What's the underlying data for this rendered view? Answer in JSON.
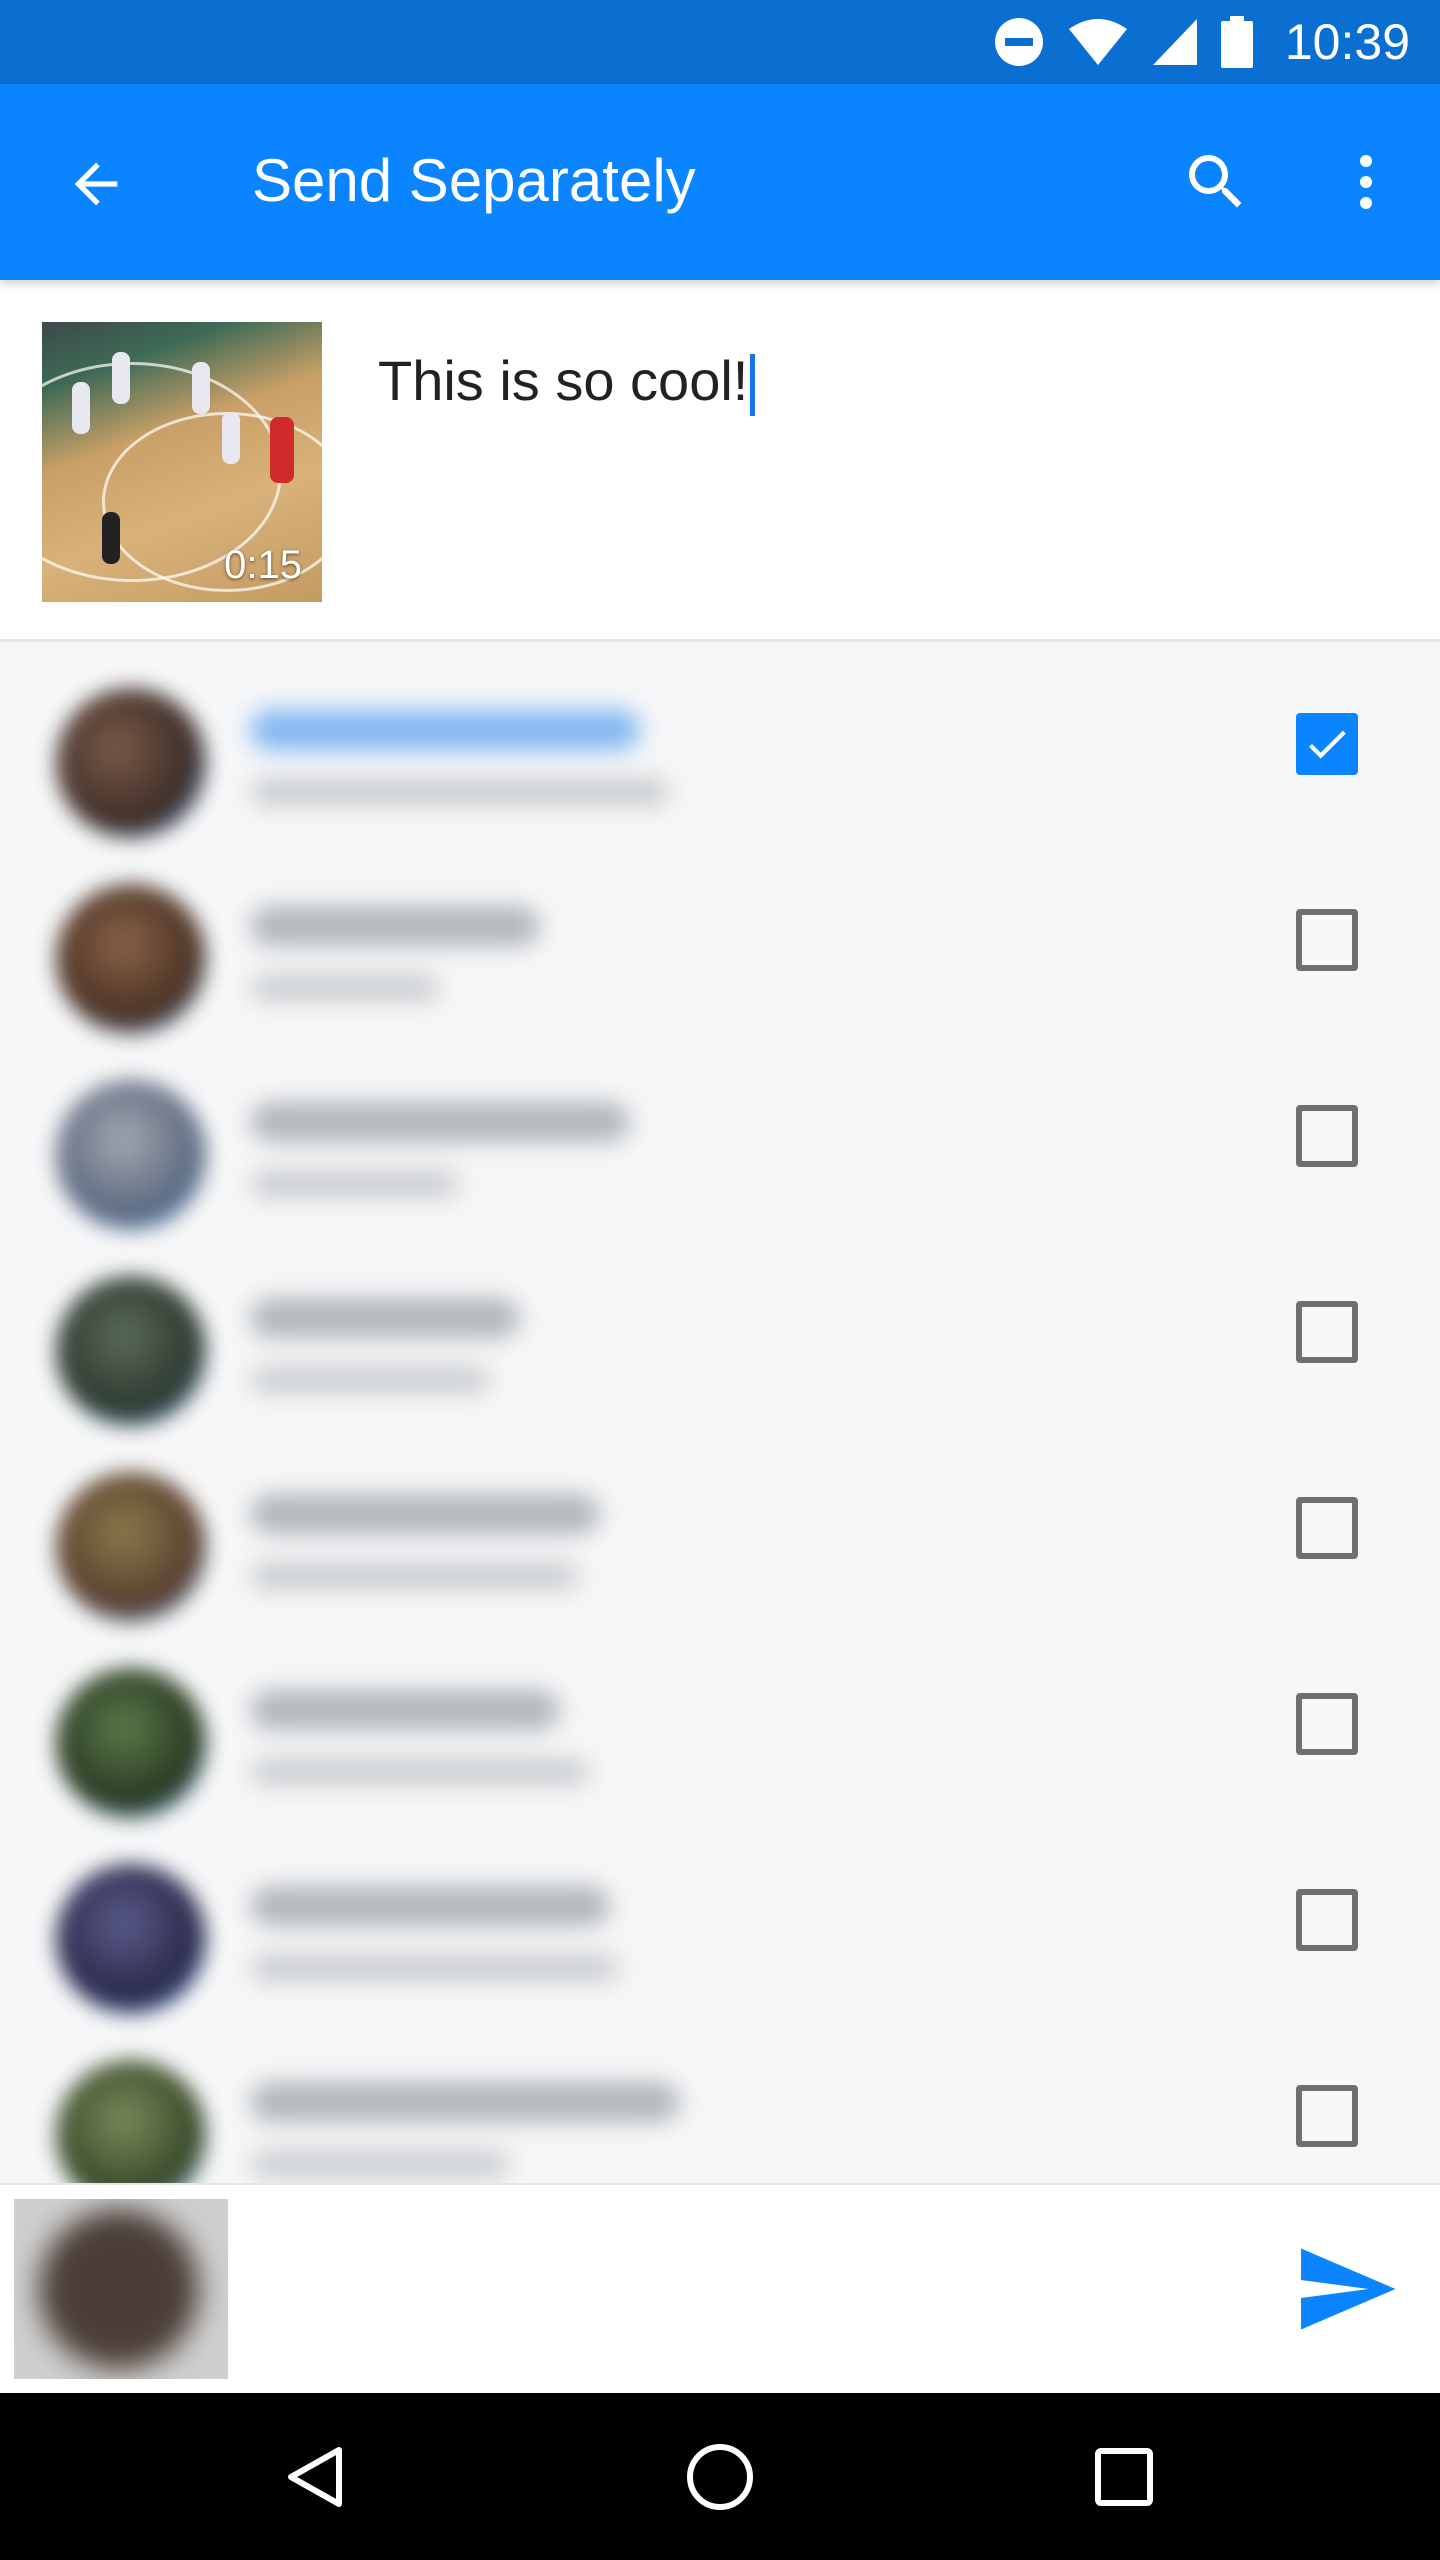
{
  "status_bar": {
    "time": "10:39",
    "icons": [
      "do-not-disturb-icon",
      "wifi-icon",
      "signal-icon",
      "battery-icon"
    ]
  },
  "app_bar": {
    "title": "Send Separately",
    "back_icon": "arrow-back-icon",
    "search_icon": "search-icon",
    "more_icon": "more-vert-icon",
    "color": "#0a84ff"
  },
  "compose": {
    "media_duration": "0:15",
    "message": "This is so cool!"
  },
  "contacts": [
    {
      "checked": true
    },
    {
      "checked": false
    },
    {
      "checked": false
    },
    {
      "checked": false
    },
    {
      "checked": false
    },
    {
      "checked": false
    },
    {
      "checked": false
    },
    {
      "checked": false
    }
  ],
  "bottom_bar": {
    "send_icon": "send-icon"
  },
  "nav_bar": {
    "buttons": [
      "back-icon",
      "home-icon",
      "recents-icon"
    ]
  }
}
